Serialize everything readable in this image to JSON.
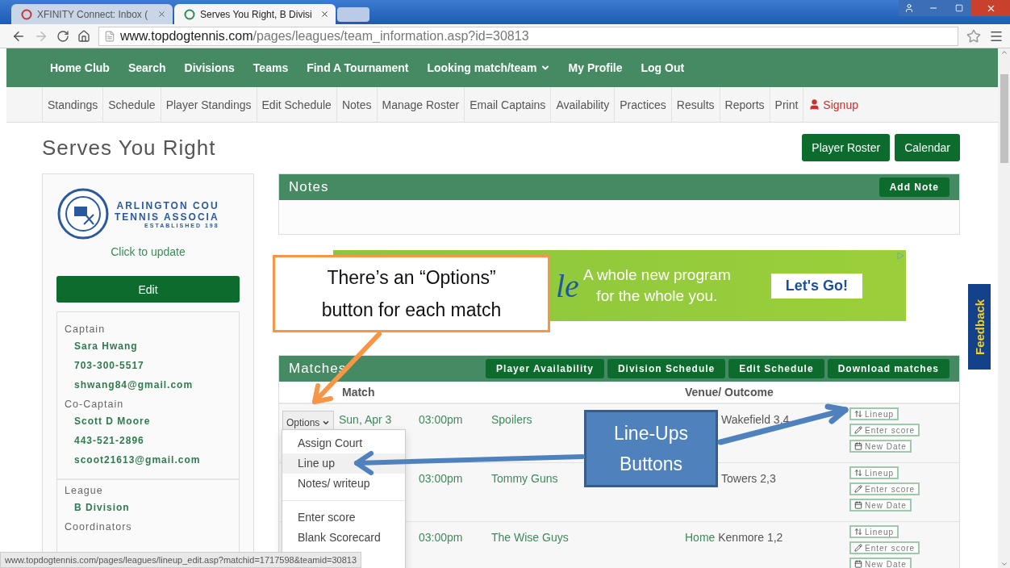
{
  "browser": {
    "tabs": [
      {
        "title": "XFINITY Connect: Inbox (",
        "selected": false
      },
      {
        "title": "Serves You Right, B Divisi",
        "selected": true
      }
    ],
    "url_host": "www.topdogtennis.com",
    "url_path": "/pages/leagues/team_information.asp?id=30813"
  },
  "nav": {
    "items": [
      {
        "label": "Home Club",
        "dropdown": false
      },
      {
        "label": "Search",
        "dropdown": false
      },
      {
        "label": "Divisions",
        "dropdown": false
      },
      {
        "label": "Teams",
        "dropdown": false
      },
      {
        "label": "Find A Tournament",
        "dropdown": false
      },
      {
        "label": "Looking match/team",
        "dropdown": true
      },
      {
        "label": "My Profile",
        "dropdown": false
      },
      {
        "label": "Log Out",
        "dropdown": false
      }
    ]
  },
  "subnav": {
    "items": [
      {
        "label": "Standings",
        "kind": "plain"
      },
      {
        "label": "Schedule",
        "kind": "plain"
      },
      {
        "label": "Player Standings",
        "kind": "plain"
      },
      {
        "label": "Edit Schedule",
        "kind": "plain"
      },
      {
        "label": "Notes",
        "kind": "plain"
      },
      {
        "label": "Manage Roster",
        "kind": "plain"
      },
      {
        "label": "Email Captains",
        "kind": "plain"
      },
      {
        "label": "Availability",
        "kind": "plain"
      },
      {
        "label": "Practices",
        "kind": "plain"
      },
      {
        "label": "Results",
        "kind": "plain"
      },
      {
        "label": "Reports",
        "kind": "plain"
      },
      {
        "label": "Print",
        "kind": "plain"
      },
      {
        "label": "Signup",
        "kind": "signup"
      }
    ]
  },
  "team_title": "Serves You Right",
  "header_buttons": [
    "Player Roster",
    "Calendar"
  ],
  "sidebar": {
    "logo_lines": [
      "ARLINGTON COU",
      "TENNIS ASSOCIA",
      "ESTABLISHED 198"
    ],
    "logo_link": "Click to update",
    "edit_button": "Edit",
    "sections": [
      {
        "heading": "Captain",
        "values": [
          "Sara Hwang",
          "703-300-5517",
          "shwang84@gmail.com"
        ]
      },
      {
        "heading": "Co-Captain",
        "values": [
          "Scott D Moore",
          "443-521-2896",
          "scoot21613@gmail.com"
        ]
      },
      {
        "heading": "League",
        "values": [
          "B Division"
        ]
      },
      {
        "heading": "Coordinators"
      }
    ]
  },
  "notes": {
    "title": "Notes",
    "button": "Add Note"
  },
  "ad": {
    "logo_fragment": "le",
    "headline": "A whole new program",
    "subline": "for the whole you.",
    "cta": "Let's Go!"
  },
  "matches": {
    "title": "Matches",
    "buttons": [
      "Player Availability",
      "Division Schedule",
      "Edit Schedule",
      "Download matches"
    ],
    "columns": [
      "Match",
      "Venue/ Outcome"
    ],
    "rows": [
      {
        "options": "Options",
        "date": "Sun, Apr 3",
        "time": "03:00pm",
        "opponent": "Spoilers",
        "venue_place": "Wakefield 3,4",
        "actions": [
          "Lineup",
          "Enter score",
          "New Date"
        ]
      },
      {
        "time": "03:00pm",
        "opponent": "Tommy Guns",
        "venue_place": "Towers 2,3",
        "actions": [
          "Lineup",
          "Enter score",
          "New Date"
        ]
      },
      {
        "time": "03:00pm",
        "opponent": "The Wise Guys",
        "venue_side": "Home",
        "venue_place": "Kenmore 1,2",
        "actions": [
          "Lineup",
          "Enter score",
          "New Date"
        ]
      }
    ]
  },
  "options_menu": {
    "groups": [
      [
        {
          "label": "Assign Court",
          "highlighted": false
        },
        {
          "label": "Line up",
          "highlighted": true
        },
        {
          "label": "Notes/ writeup",
          "highlighted": false
        }
      ],
      [
        {
          "label": "Enter score",
          "highlighted": false
        },
        {
          "label": "Blank Scorecard",
          "highlighted": false
        }
      ]
    ]
  },
  "feedback_tab": "Feedback",
  "status_url": "www.topdogtennis.com/pages/leagues/lineup_edit.asp?matchid=1717598&teamid=30813",
  "callouts": [
    {
      "kind": "outlined",
      "text": "There’s an “Options” button for each match"
    },
    {
      "kind": "filled",
      "text": "Line-Ups Buttons"
    }
  ]
}
